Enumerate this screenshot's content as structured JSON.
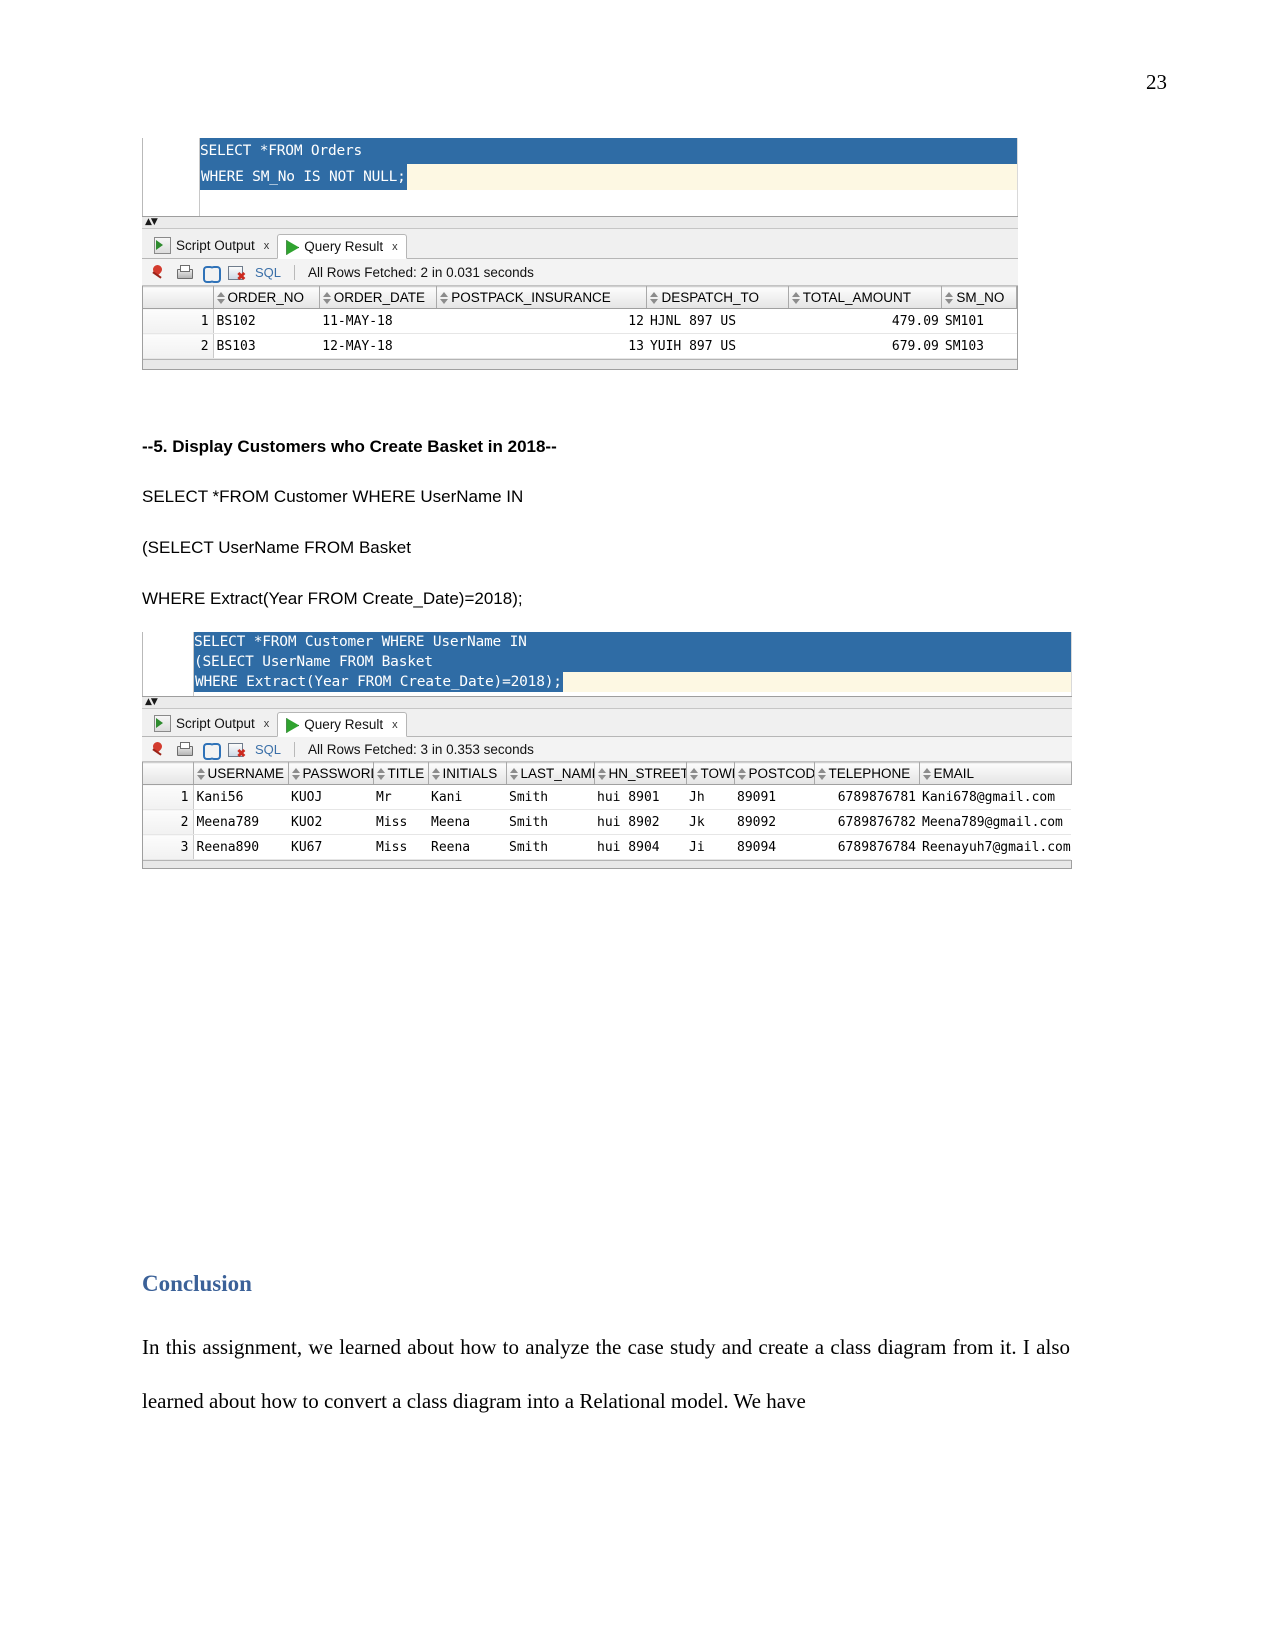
{
  "page": {
    "number": "23"
  },
  "screenshot1": {
    "editor": {
      "lines": [
        "SELECT *FROM Orders",
        "WHERE SM_No IS NOT NULL;"
      ]
    },
    "tabs": [
      {
        "label": "Script Output",
        "icon": "script-output-icon",
        "close": "x",
        "active": false
      },
      {
        "label": "Query Result",
        "icon": "play-icon",
        "close": "x",
        "active": true
      }
    ],
    "toolbar": {
      "icons": [
        "pin-icon",
        "print-icon",
        "refresh-icon",
        "unpost-icon"
      ],
      "sql_label": "SQL",
      "status": "All Rows Fetched: 2 in 0.031 seconds"
    },
    "grid": {
      "columns": [
        "ORDER_NO",
        "ORDER_DATE",
        "POSTPACK_INSURANCE",
        "DESPATCH_TO",
        "TOTAL_AMOUNT",
        "SM_NO"
      ],
      "rows": [
        {
          "n": "1",
          "cells": [
            "BS102",
            "11-MAY-18",
            "12",
            "HJNL 897 US",
            "479.09",
            "SM101"
          ]
        },
        {
          "n": "2",
          "cells": [
            "BS103",
            "12-MAY-18",
            "13",
            "YUIH 897 US",
            "679.09",
            "SM103"
          ]
        }
      ]
    }
  },
  "section5": {
    "heading": "--5. Display Customers who Create Basket in 2018--",
    "line1": "SELECT *FROM Customer WHERE UserName IN",
    "line2": "(SELECT UserName FROM Basket",
    "line3": "WHERE Extract(Year FROM Create_Date)=2018);"
  },
  "screenshot2": {
    "editor": {
      "lines": [
        "SELECT *FROM Customer WHERE UserName IN",
        "(SELECT UserName FROM Basket",
        "WHERE Extract(Year FROM Create_Date)=2018);"
      ]
    },
    "tabs": [
      {
        "label": "Script Output",
        "icon": "script-output-icon",
        "close": "x",
        "active": false
      },
      {
        "label": "Query Result",
        "icon": "play-icon",
        "close": "x",
        "active": true
      }
    ],
    "toolbar": {
      "icons": [
        "pin-icon",
        "print-icon",
        "refresh-icon",
        "unpost-icon"
      ],
      "sql_label": "SQL",
      "status": "All Rows Fetched: 3 in 0.353 seconds"
    },
    "grid": {
      "columns": [
        "USERNAME",
        "PASSWORD",
        "TITLE",
        "INITIALS",
        "LAST_NAME",
        "HN_STREET",
        "TOWN",
        "POSTCODE",
        "TELEPHONE",
        "EMAIL"
      ],
      "rows": [
        {
          "n": "1",
          "cells": [
            "Kani56",
            "KUOJ",
            "Mr",
            "Kani",
            "Smith",
            "hui 8901",
            "Jh",
            "89091",
            "6789876781",
            "Kani678@gmail.com"
          ]
        },
        {
          "n": "2",
          "cells": [
            "Meena789",
            "KUO2",
            "Miss",
            "Meena",
            "Smith",
            "hui 8902",
            "Jk",
            "89092",
            "6789876782",
            "Meena789@gmail.com"
          ]
        },
        {
          "n": "3",
          "cells": [
            "Reena890",
            "KU67",
            "Miss",
            "Reena",
            "Smith",
            "hui 8904",
            "Ji",
            "89094",
            "6789876784",
            "Reenayuh7@gmail.com"
          ]
        }
      ]
    }
  },
  "conclusion": {
    "heading": "Conclusion",
    "paragraph": "In this assignment, we learned about how to analyze the case study and create a class diagram from it. I also learned about how to convert a class diagram into a Relational model. We have"
  },
  "colors": {
    "selection_blue": "#2f6ca5",
    "caret_line": "#fdf8e3",
    "heading_blue": "#3b6198",
    "sql_link": "#3a6fa8"
  }
}
